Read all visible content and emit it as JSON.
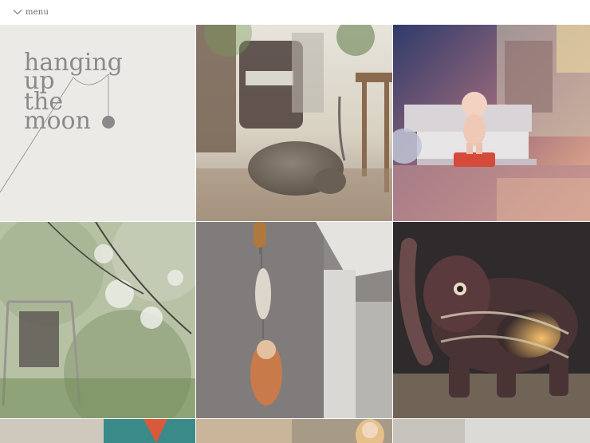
{
  "header": {
    "menu_label": "menu",
    "menu_icon": "chevron-down-icon"
  },
  "logo": {
    "lines": [
      "hanging",
      "up",
      "the",
      "moon"
    ]
  },
  "tiles": [
    {
      "id": "logo",
      "subject": "hanging up the moon logo"
    },
    {
      "id": "cat",
      "subject": "cat resting on rug in living room"
    },
    {
      "id": "kewpie",
      "subject": "kewpie doll on stack of books"
    },
    {
      "id": "lamp",
      "subject": "lantern in blossoming tree"
    },
    {
      "id": "mobile",
      "subject": "hanging matryoshka mobile"
    },
    {
      "id": "elephant",
      "subject": "elephant lantern with candle"
    },
    {
      "id": "bottom-1",
      "subject": "partial photo"
    },
    {
      "id": "bottom-2",
      "subject": "partial photo with matryoshka"
    },
    {
      "id": "bottom-3",
      "subject": "partial photo"
    }
  ],
  "colors": {
    "logo_bg": "#efedea",
    "logo_text": "#8a8a8a"
  }
}
